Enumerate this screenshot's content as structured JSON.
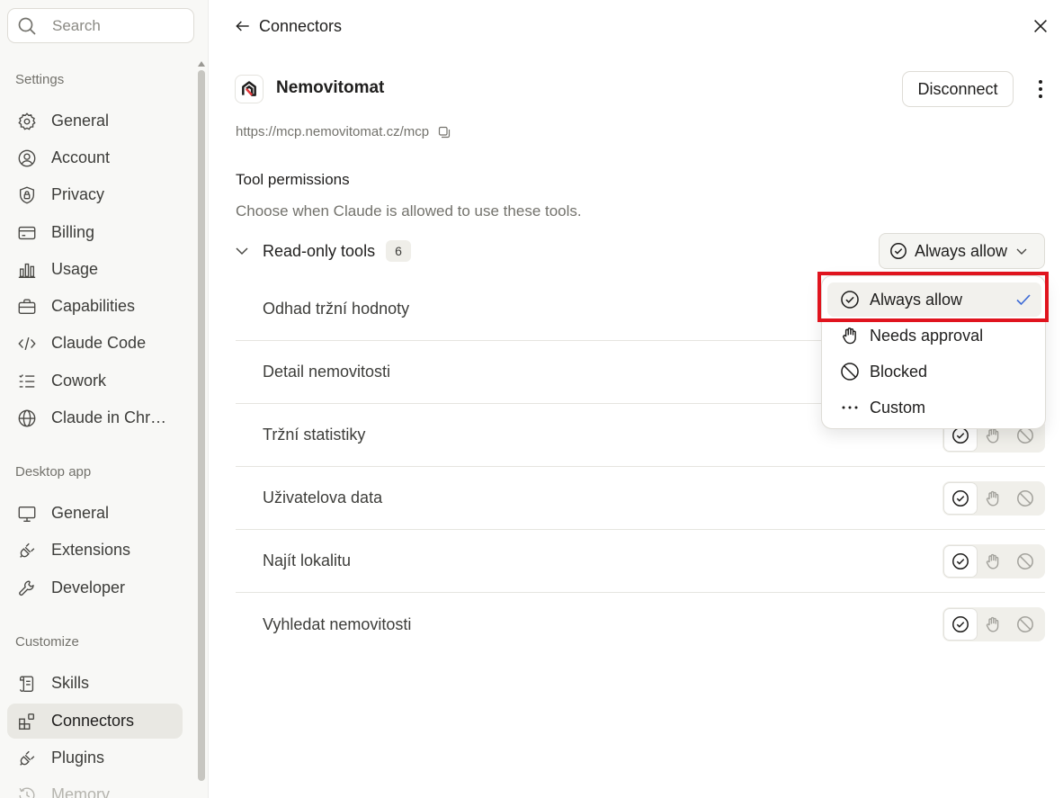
{
  "sidebar": {
    "search_placeholder": "Search",
    "sections": {
      "settings": "Settings",
      "desktop": "Desktop app",
      "customize": "Customize"
    },
    "settings_items": [
      {
        "label": "General",
        "icon": "gear-icon"
      },
      {
        "label": "Account",
        "icon": "user-circle-icon"
      },
      {
        "label": "Privacy",
        "icon": "shield-lock-icon"
      },
      {
        "label": "Billing",
        "icon": "credit-card-icon"
      },
      {
        "label": "Usage",
        "icon": "bar-chart-icon"
      },
      {
        "label": "Capabilities",
        "icon": "briefcase-icon"
      },
      {
        "label": "Claude Code",
        "icon": "code-icon"
      },
      {
        "label": "Cowork",
        "icon": "checklist-icon"
      },
      {
        "label": "Claude in Chr…",
        "icon": "globe-icon"
      }
    ],
    "desktop_items": [
      {
        "label": "General",
        "icon": "monitor-icon"
      },
      {
        "label": "Extensions",
        "icon": "plug-icon"
      },
      {
        "label": "Developer",
        "icon": "wrench-icon"
      }
    ],
    "customize_items": [
      {
        "label": "Skills",
        "icon": "scroll-icon"
      },
      {
        "label": "Connectors",
        "icon": "grid-plus-icon",
        "active": true
      },
      {
        "label": "Plugins",
        "icon": "plug-icon"
      },
      {
        "label": "Memory",
        "icon": "history-icon"
      }
    ]
  },
  "header": {
    "back_label": "Connectors"
  },
  "connector": {
    "name": "Nemovitomat",
    "url": "https://mcp.nemovitomat.cz/mcp",
    "disconnect_label": "Disconnect",
    "logo_color": "#e4373a"
  },
  "permissions": {
    "title": "Tool permissions",
    "description": "Choose when Claude is allowed to use these tools.",
    "group": {
      "label": "Read-only tools",
      "count": "6",
      "selected": "Always allow"
    },
    "tools": [
      {
        "name": "Odhad tržní hodnoty",
        "selected": "always-allow"
      },
      {
        "name": "Detail nemovitosti",
        "selected": "always-allow"
      },
      {
        "name": "Tržní statistiky",
        "selected": "always-allow"
      },
      {
        "name": "Uživatelova data",
        "selected": "always-allow"
      },
      {
        "name": "Najít lokalitu",
        "selected": "always-allow"
      },
      {
        "name": "Vyhledat nemovitosti",
        "selected": "always-allow"
      }
    ]
  },
  "dropdown": {
    "options": [
      {
        "label": "Always allow",
        "icon": "check-circle-icon",
        "checked": true
      },
      {
        "label": "Needs approval",
        "icon": "hand-icon"
      },
      {
        "label": "Blocked",
        "icon": "blocked-icon"
      },
      {
        "label": "Custom",
        "icon": "ellipsis-icon"
      }
    ]
  },
  "colors": {
    "accent_check": "#3e6bd6",
    "highlight": "#e0141e"
  }
}
